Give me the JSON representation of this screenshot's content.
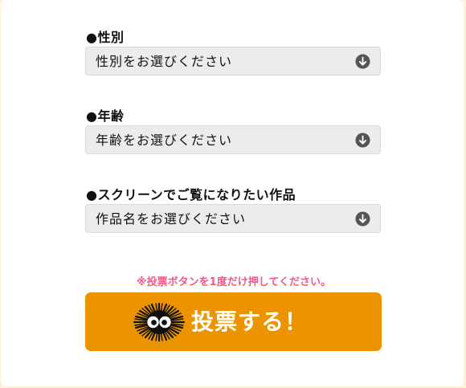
{
  "form": {
    "gender": {
      "label": "●性別",
      "selected": "性別をお選びください"
    },
    "age": {
      "label": "●年齢",
      "selected": "年齢をお選びください"
    },
    "work": {
      "label": "●スクリーンでご覧になりたい作品",
      "selected": "作品名をお選びください"
    },
    "notice": "※投票ボタンを1度だけ押してください。",
    "vote_button": {
      "label": "投票する！",
      "mascot_icon": "soot-sprite-icon"
    }
  },
  "colors": {
    "page_background": "#fdf3d2",
    "card_background": "#ffffff",
    "select_background": "#ececec",
    "select_arrow": "#555555",
    "notice_text": "#ef5a84",
    "vote_button": "#eb9400",
    "vote_text": "#ffffff"
  },
  "icons": {
    "select_arrow": "arrow-down-circle-icon"
  }
}
